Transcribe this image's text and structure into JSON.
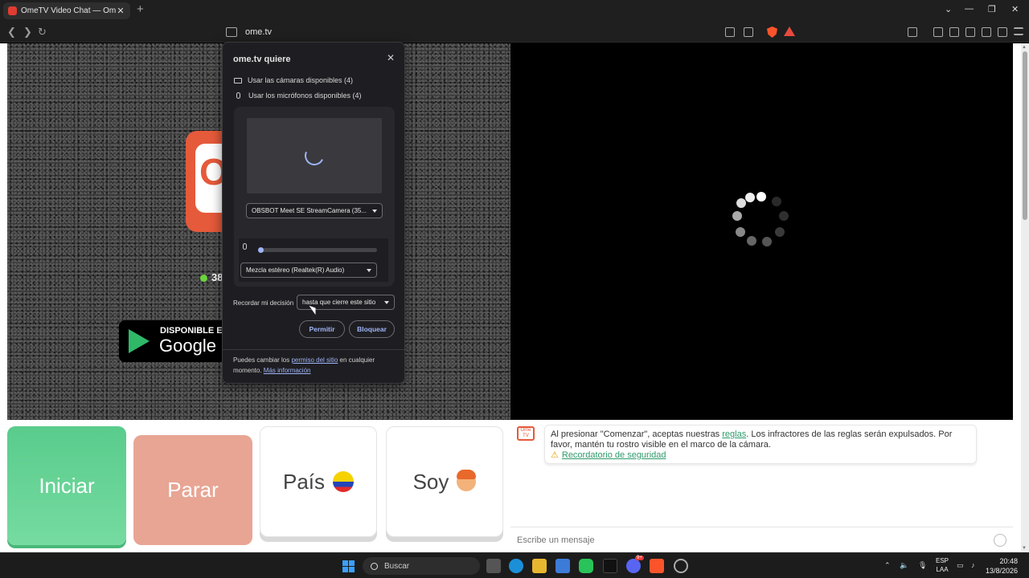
{
  "browser": {
    "tab_title": "OmeTV Video Chat — Omegle R",
    "tab_close": "✕",
    "new_tab": "+",
    "url": "ome.tv",
    "min": "⌄",
    "minimize": "—",
    "maximize": "❐",
    "close": "✕"
  },
  "left_panel": {
    "logo_letter": "O",
    "online_count": "38",
    "play_small": "DISPONIBLE EN",
    "play_big": "Google P"
  },
  "buttons": {
    "start": "Iniciar",
    "stop": "Parar",
    "country": "País",
    "iam": "Soy"
  },
  "chat": {
    "logo": "Ome TV",
    "message_prefix": "Al presionar \"Comenzar\", aceptas nuestras ",
    "rules_link": "reglas",
    "message_suffix": ". Los infractores de las reglas serán expulsados. Por favor, mantén tu rostro visible en el marco de la cámara.",
    "safety_link": "Recordatorio de seguridad",
    "input_placeholder": "Escribe un mensaje"
  },
  "permission": {
    "title": "ome.tv quiere",
    "close": "✕",
    "camera_text": "Usar las cámaras disponibles (4)",
    "mic_text": "Usar los micrófonos disponibles (4)",
    "camera_select": "OBSBOT Meet SE StreamCamera (35...",
    "mic_select": "Mezcla estéreo (Realtek(R) Audio)",
    "remember_label": "Recordar mi decisión",
    "remember_select": "hasta que cierre este sitio",
    "allow": "Permitir",
    "block": "Bloquear",
    "footer_prefix": "Puedes cambiar los ",
    "footer_link": "permiso del sitio",
    "footer_middle": " en cualquier momento. ",
    "footer_more": "Más información"
  },
  "taskbar": {
    "search": "Buscar",
    "lang_1": "ESP",
    "lang_2": "LAA",
    "time": "20:48",
    "date": "13/8/2026",
    "discord_badge": "9+"
  },
  "colors": {
    "start": "#59cc8c",
    "stop": "#e8a594",
    "accent": "#9fb4f6",
    "brand": "#e55a3a"
  }
}
